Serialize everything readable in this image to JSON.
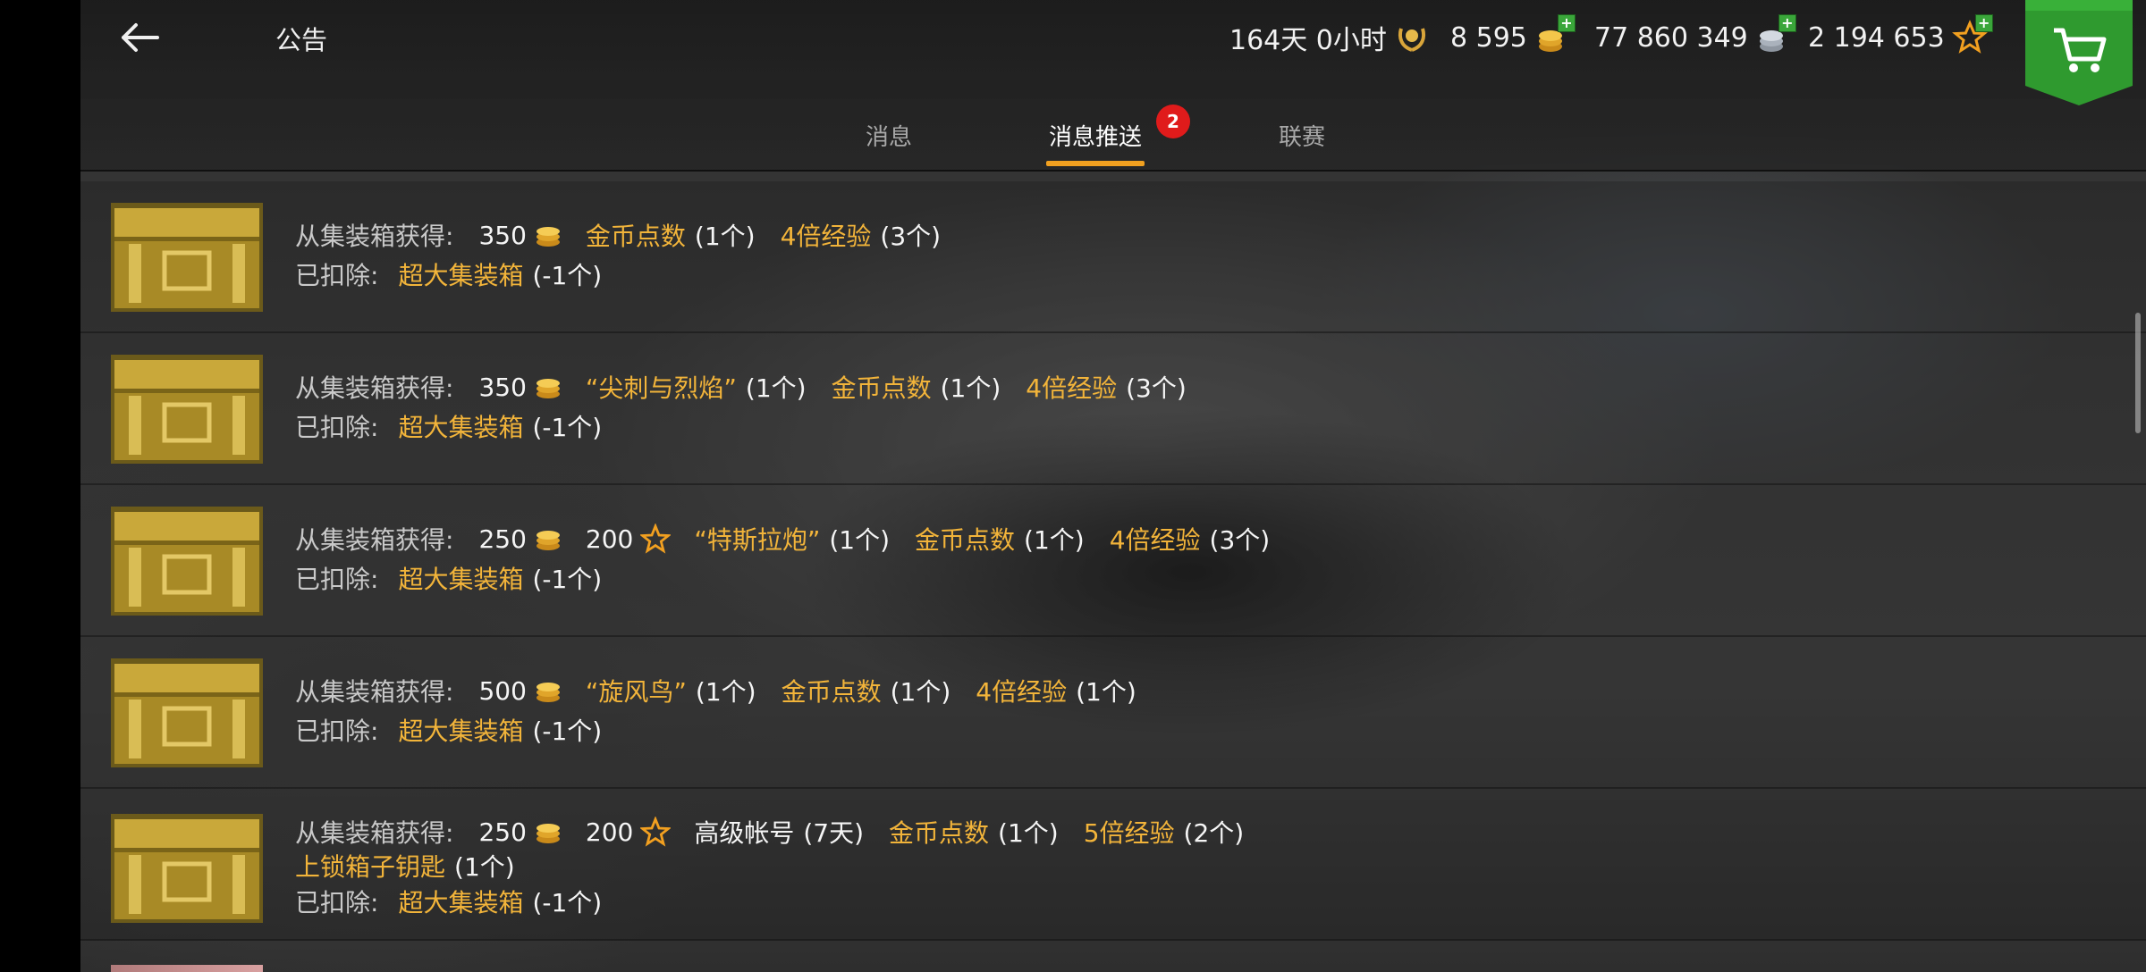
{
  "header": {
    "title": "公告",
    "premium_time": "164天 0小时",
    "gold": "8 595",
    "silver": "77 860 349",
    "stars": "2 194 653"
  },
  "tabs": [
    {
      "label": "消息"
    },
    {
      "label": "消息推送",
      "badge": "2"
    },
    {
      "label": "联赛"
    }
  ],
  "common": {
    "obtained_label": "从集装箱获得:",
    "deducted_label": "已扣除:",
    "deducted_item": "超大集装箱",
    "deducted_count": "(-1个)"
  },
  "rows": [
    {
      "line1": [
        {
          "kind": "num",
          "text": "350"
        },
        {
          "kind": "coin"
        },
        {
          "kind": "gold",
          "text": "金币点数"
        },
        {
          "kind": "cnt",
          "text": "(1个)"
        },
        {
          "kind": "gold",
          "text": "4倍经验"
        },
        {
          "kind": "cnt",
          "text": "(3个)"
        }
      ]
    },
    {
      "line1": [
        {
          "kind": "num",
          "text": "350"
        },
        {
          "kind": "coin"
        },
        {
          "kind": "gold",
          "text": "“尖刺与烈焰”"
        },
        {
          "kind": "cnt",
          "text": "(1个)"
        },
        {
          "kind": "gold",
          "text": "金币点数"
        },
        {
          "kind": "cnt",
          "text": "(1个)"
        },
        {
          "kind": "gold",
          "text": "4倍经验"
        },
        {
          "kind": "cnt",
          "text": "(3个)"
        }
      ]
    },
    {
      "line1": [
        {
          "kind": "num",
          "text": "250"
        },
        {
          "kind": "coin"
        },
        {
          "kind": "num",
          "text": "200"
        },
        {
          "kind": "star"
        },
        {
          "kind": "gold",
          "text": "“特斯拉炮”"
        },
        {
          "kind": "cnt",
          "text": "(1个)"
        },
        {
          "kind": "gold",
          "text": "金币点数"
        },
        {
          "kind": "cnt",
          "text": "(1个)"
        },
        {
          "kind": "gold",
          "text": "4倍经验"
        },
        {
          "kind": "cnt",
          "text": "(3个)"
        }
      ]
    },
    {
      "line1": [
        {
          "kind": "num",
          "text": "500"
        },
        {
          "kind": "coin"
        },
        {
          "kind": "gold",
          "text": "“旋风鸟”"
        },
        {
          "kind": "cnt",
          "text": "(1个)"
        },
        {
          "kind": "gold",
          "text": "金币点数"
        },
        {
          "kind": "cnt",
          "text": "(1个)"
        },
        {
          "kind": "gold",
          "text": "4倍经验"
        },
        {
          "kind": "cnt",
          "text": "(1个)"
        }
      ]
    },
    {
      "line1": [
        {
          "kind": "num",
          "text": "250"
        },
        {
          "kind": "coin"
        },
        {
          "kind": "num",
          "text": "200"
        },
        {
          "kind": "star"
        },
        {
          "kind": "white",
          "text": "高级帐号"
        },
        {
          "kind": "cnt",
          "text": "(7天)"
        },
        {
          "kind": "gold",
          "text": "金币点数"
        },
        {
          "kind": "cnt",
          "text": "(1个)"
        },
        {
          "kind": "gold",
          "text": "5倍经验"
        },
        {
          "kind": "cnt",
          "text": "(2个)"
        }
      ],
      "line2": [
        {
          "kind": "gold",
          "text": "上锁箱子钥匙"
        },
        {
          "kind": "cnt",
          "text": "(1个)"
        }
      ]
    }
  ]
}
